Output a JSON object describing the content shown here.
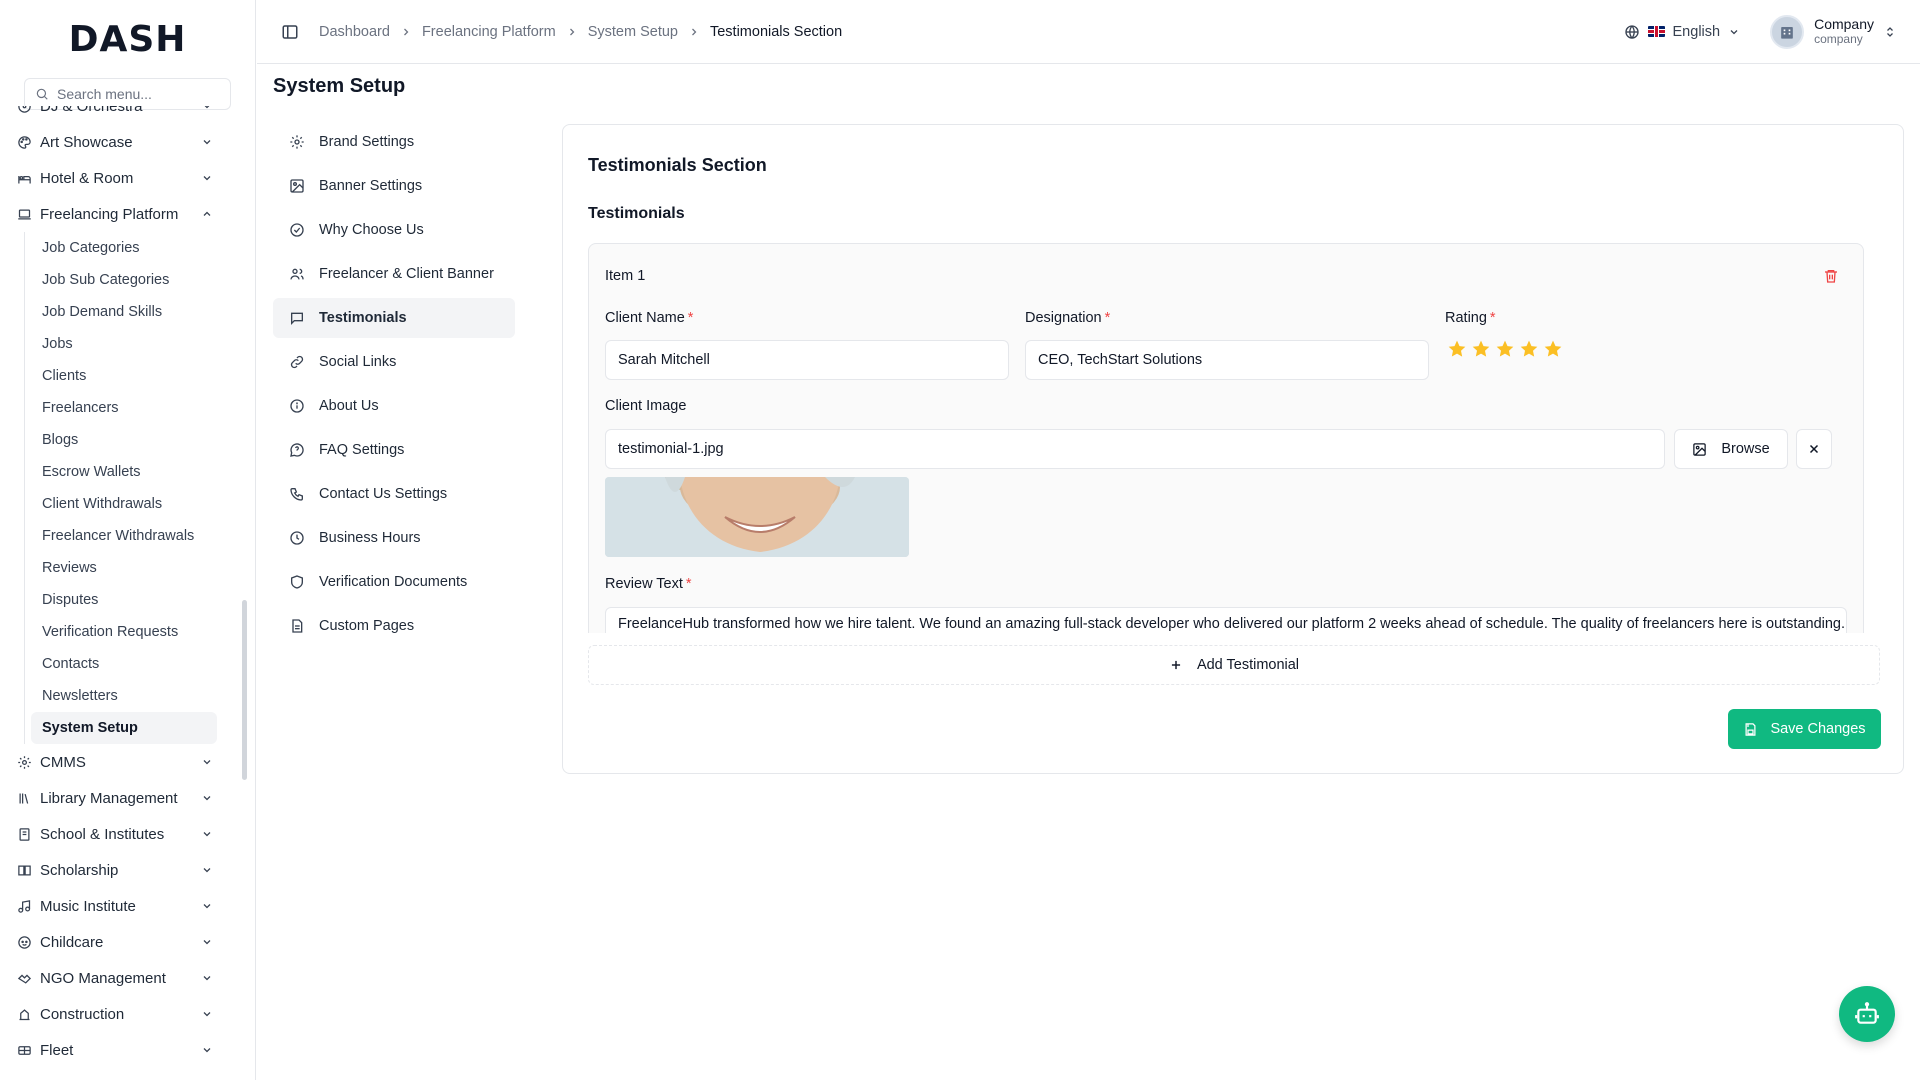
{
  "app": {
    "logo": "DASH"
  },
  "search": {
    "placeholder": "Search menu..."
  },
  "sidebar": {
    "items_top": [
      {
        "label": "DJ & Orchestra",
        "icon": "disc-icon"
      },
      {
        "label": "Art Showcase",
        "icon": "palette-icon"
      },
      {
        "label": "Hotel & Room",
        "icon": "bed-icon"
      },
      {
        "label": "Freelancing Platform",
        "icon": "laptop-icon"
      }
    ],
    "sub_items": [
      "Job Categories",
      "Job Sub Categories",
      "Job Demand Skills",
      "Jobs",
      "Clients",
      "Freelancers",
      "Blogs",
      "Escrow Wallets",
      "Client Withdrawals",
      "Freelancer Withdrawals",
      "Reviews",
      "Disputes",
      "Verification Requests",
      "Contacts",
      "Newsletters",
      "System Setup"
    ],
    "items_bottom": [
      {
        "label": "CMMS",
        "icon": "gear-icon"
      },
      {
        "label": "Library Management",
        "icon": "library-icon"
      },
      {
        "label": "School & Institutes",
        "icon": "school-icon"
      },
      {
        "label": "Scholarship",
        "icon": "scholarship-icon"
      },
      {
        "label": "Music Institute",
        "icon": "music-icon"
      },
      {
        "label": "Childcare",
        "icon": "childcare-icon"
      },
      {
        "label": "NGO Management",
        "icon": "handshake-icon"
      },
      {
        "label": "Construction",
        "icon": "construction-icon"
      },
      {
        "label": "Fleet",
        "icon": "truck-icon"
      }
    ]
  },
  "header": {
    "breadcrumbs": [
      "Dashboard",
      "Freelancing Platform",
      "System Setup",
      "Testimonials Section"
    ],
    "language": "English",
    "user": {
      "name": "Company",
      "role": "company"
    }
  },
  "page": {
    "title": "System Setup"
  },
  "settings_nav": [
    {
      "label": "Brand Settings",
      "icon": "gear-icon"
    },
    {
      "label": "Banner Settings",
      "icon": "image-icon"
    },
    {
      "label": "Why Choose Us",
      "icon": "check-circle-icon"
    },
    {
      "label": "Freelancer & Client Banner",
      "icon": "users-icon"
    },
    {
      "label": "Testimonials",
      "icon": "message-icon",
      "active": true
    },
    {
      "label": "Social Links",
      "icon": "link-icon"
    },
    {
      "label": "About Us",
      "icon": "info-icon"
    },
    {
      "label": "FAQ Settings",
      "icon": "help-circle-icon"
    },
    {
      "label": "Contact Us Settings",
      "icon": "phone-icon"
    },
    {
      "label": "Business Hours",
      "icon": "clock-icon"
    },
    {
      "label": "Verification Documents",
      "icon": "shield-icon"
    },
    {
      "label": "Custom Pages",
      "icon": "file-icon"
    }
  ],
  "card": {
    "title": "Testimonials Section",
    "section_title": "Testimonials",
    "item": {
      "label": "Item 1",
      "client_name_label": "Client Name",
      "client_name": "Sarah Mitchell",
      "designation_label": "Designation",
      "designation": "CEO, TechStart Solutions",
      "rating_label": "Rating",
      "rating": 5,
      "rating_max": 5,
      "client_image_label": "Client Image",
      "client_image": "testimonial-1.jpg",
      "browse_label": "Browse",
      "review_label": "Review Text",
      "review_text": "FreelanceHub transformed how we hire talent. We found an amazing full-stack developer who delivered our platform 2 weeks ahead of schedule. The quality of freelancers here is outstanding."
    },
    "add_label": "Add Testimonial",
    "save_label": "Save Changes"
  },
  "colors": {
    "accent": "#10b981",
    "star": "#fbbf24",
    "danger": "#ef4444",
    "required": "#ef4444"
  }
}
